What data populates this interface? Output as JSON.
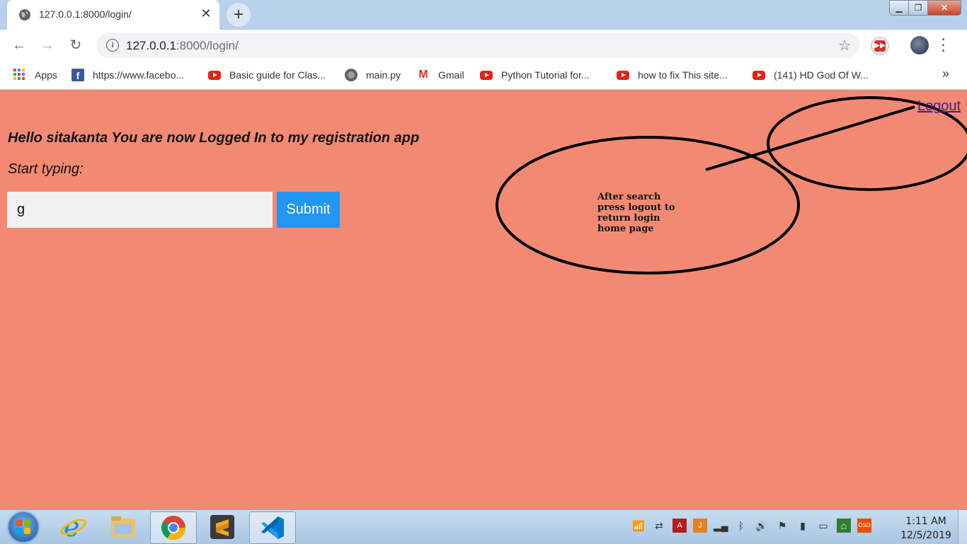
{
  "browser": {
    "tab": {
      "title": "127.0.0.1:8000/login/"
    },
    "address_bar": {
      "url_host": "127.0.0.1",
      "url_rest": ":8000/login/"
    },
    "bookmarks": [
      {
        "label": "Apps",
        "icon": "apps-icon"
      },
      {
        "label": "https://www.facebo...",
        "icon": "facebook-icon"
      },
      {
        "label": "Basic guide for Clas...",
        "icon": "youtube-icon"
      },
      {
        "label": "main.py",
        "icon": "globe-icon"
      },
      {
        "label": "Gmail",
        "icon": "gmail-icon"
      },
      {
        "label": "Python Tutorial for...",
        "icon": "youtube-icon"
      },
      {
        "label": "how to fix This site...",
        "icon": "youtube-icon"
      },
      {
        "label": "(141) HD God Of W...",
        "icon": "youtube-icon"
      }
    ],
    "more_bookmarks": "»"
  },
  "page": {
    "logout_label": "Logout",
    "greeting": "Hello sitakanta You are now Logged In to my registration app",
    "prompt": "Start typing:",
    "search_value": "g",
    "submit_label": "Submit",
    "background_color": "#f28a73",
    "annotation": {
      "lines": [
        "After search",
        "press logout to",
        "return login",
        "home page"
      ]
    }
  },
  "taskbar": {
    "time": "1:11 AM",
    "date": "12/5/2019",
    "pinned": [
      "internet-explorer-icon",
      "file-explorer-icon",
      "chrome-icon",
      "sublime-text-icon",
      "vscode-icon"
    ]
  }
}
